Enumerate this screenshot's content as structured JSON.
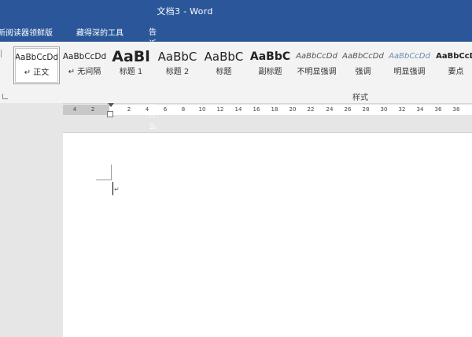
{
  "window": {
    "title": "文档3  -  Word"
  },
  "menu": {
    "items": [
      "新阅读器领鲜版",
      "藏得深的工具"
    ],
    "tell_me": "告诉我你想要做什么"
  },
  "styles": {
    "items": [
      {
        "preview": "AaBbCcDd",
        "name": "↵ 正文",
        "selected": true
      },
      {
        "preview": "AaBbCcDd",
        "name": "↵ 无间隔"
      },
      {
        "preview": "AaBl",
        "name": "标题 1"
      },
      {
        "preview": "AaBbC",
        "name": "标题 2"
      },
      {
        "preview": "AaBbC",
        "name": "标题"
      },
      {
        "preview": "AaBbC",
        "name": "副标题"
      },
      {
        "preview": "AaBbCcDd",
        "name": "不明显强调"
      },
      {
        "preview": "AaBbCcDd",
        "name": "强调"
      },
      {
        "preview": "AaBbCcDd",
        "name": "明显强调"
      },
      {
        "preview": "AaBbCcD",
        "name": "要点"
      }
    ],
    "group_label": "样式"
  },
  "ruler": {
    "ticks": [
      "4",
      "2",
      "2",
      "4",
      "6",
      "8",
      "10",
      "12",
      "14",
      "16",
      "18",
      "20",
      "22",
      "24",
      "26",
      "28",
      "30",
      "32",
      "34",
      "36",
      "38"
    ]
  },
  "document": {
    "paragraph_mark": "↵"
  },
  "colors": {
    "title_bar": "#2b579a",
    "ribbon": "#f3f3f3",
    "canvas": "#e6e6e6"
  }
}
